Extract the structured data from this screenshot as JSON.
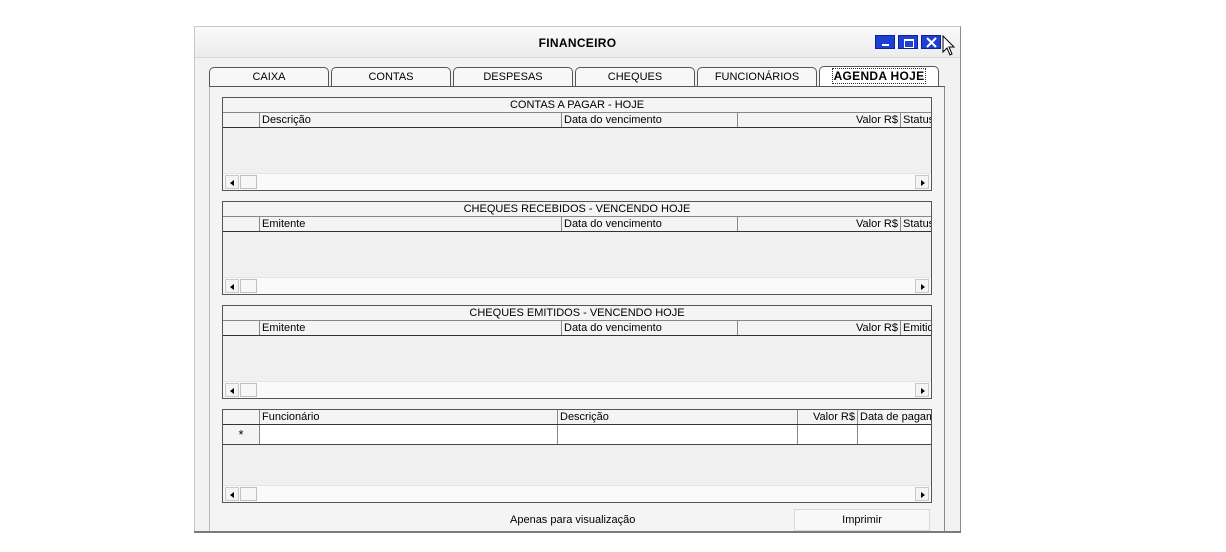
{
  "window": {
    "title": "FINANCEIRO",
    "accent_color": "#1f3fd4",
    "controls": [
      "minimize-icon",
      "maximize-icon",
      "close-icon"
    ]
  },
  "tabs": [
    {
      "label": "CAIXA"
    },
    {
      "label": "CONTAS"
    },
    {
      "label": "DESPESAS"
    },
    {
      "label": "CHEQUES"
    },
    {
      "label": "FUNCIONÁRIOS"
    },
    {
      "label": "AGENDA HOJE"
    }
  ],
  "active_tab": "AGENDA HOJE",
  "grids": {
    "contas_pagar": {
      "caption": "CONTAS A PAGAR - HOJE",
      "columns": [
        "Descrição",
        "Data do vencimento",
        "Valor R$",
        "Status"
      ],
      "rows": []
    },
    "cheques_recebidos": {
      "caption": "CHEQUES RECEBIDOS - VENCENDO HOJE",
      "columns": [
        "Emitente",
        "Data do vencimento",
        "Valor R$",
        "Status"
      ],
      "rows": []
    },
    "cheques_emitidos": {
      "caption": "CHEQUES EMITIDOS - VENCENDO HOJE",
      "columns": [
        "Emitente",
        "Data do vencimento",
        "Valor R$",
        "Emitido"
      ],
      "rows": []
    },
    "funcionarios": {
      "columns": [
        "Funcionário",
        "Descrição",
        "Valor R$",
        "Data de pagamento"
      ],
      "new_row_marker": "*",
      "rows": []
    }
  },
  "footer": {
    "status": "Apenas para visualização",
    "print_label": "Imprimir"
  }
}
